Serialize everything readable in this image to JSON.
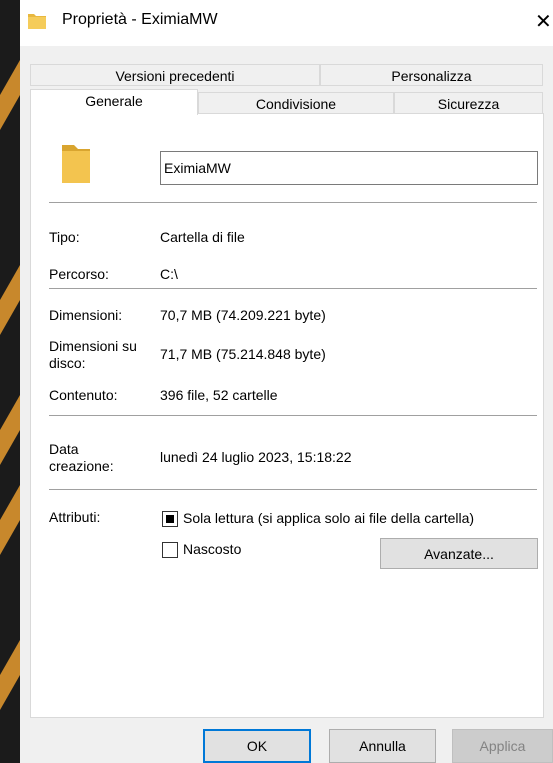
{
  "window": {
    "title": "Proprietà - EximiaMW",
    "close_glyph": "✕"
  },
  "tabs": {
    "row_back": [
      {
        "label": "Versioni precedenti"
      },
      {
        "label": "Personalizza"
      }
    ],
    "row_front": [
      {
        "label": "Generale",
        "active": true
      },
      {
        "label": "Condivisione"
      },
      {
        "label": "Sicurezza"
      }
    ]
  },
  "general": {
    "folder_icon": "folder-icon",
    "name_value": "EximiaMW",
    "rows": [
      {
        "label": "Tipo:",
        "value": "Cartella di file"
      },
      {
        "label": "Percorso:",
        "value": "C:\\"
      },
      {
        "label": "Dimensioni:",
        "value": "70,7 MB (74.209.221 byte)"
      },
      {
        "label": "Dimensioni su disco:",
        "value": "71,7 MB (75.214.848 byte)"
      },
      {
        "label": "Contenuto:",
        "value": "396 file, 52 cartelle"
      },
      {
        "label": "Data creazione:",
        "value": "lunedì 24 luglio 2023, 15:18:22"
      }
    ],
    "attributes_label": "Attributi:",
    "readonly_label": "Sola lettura (si applica solo ai file della cartella)",
    "readonly_state": "indeterminate",
    "hidden_label": "Nascosto",
    "hidden_checked": false,
    "advanced_label": "Avanzate..."
  },
  "footer": {
    "ok_label": "OK",
    "cancel_label": "Annulla",
    "apply_label": "Applica"
  },
  "colors": {
    "accent": "#0078d7",
    "background": "#1b1b1b",
    "decor_stripe": "#c8882c"
  }
}
